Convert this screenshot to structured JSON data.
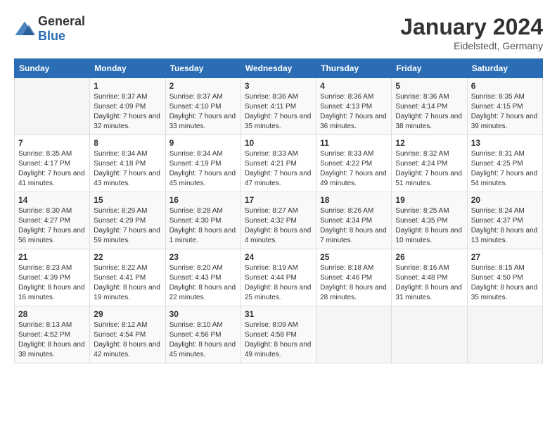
{
  "logo": {
    "general": "General",
    "blue": "Blue"
  },
  "header": {
    "month_year": "January 2024",
    "location": "Eidelstedt, Germany"
  },
  "weekdays": [
    "Sunday",
    "Monday",
    "Tuesday",
    "Wednesday",
    "Thursday",
    "Friday",
    "Saturday"
  ],
  "weeks": [
    [
      {
        "day": "",
        "sunrise": "",
        "sunset": "",
        "daylight": ""
      },
      {
        "day": "1",
        "sunrise": "Sunrise: 8:37 AM",
        "sunset": "Sunset: 4:09 PM",
        "daylight": "Daylight: 7 hours and 32 minutes."
      },
      {
        "day": "2",
        "sunrise": "Sunrise: 8:37 AM",
        "sunset": "Sunset: 4:10 PM",
        "daylight": "Daylight: 7 hours and 33 minutes."
      },
      {
        "day": "3",
        "sunrise": "Sunrise: 8:36 AM",
        "sunset": "Sunset: 4:11 PM",
        "daylight": "Daylight: 7 hours and 35 minutes."
      },
      {
        "day": "4",
        "sunrise": "Sunrise: 8:36 AM",
        "sunset": "Sunset: 4:13 PM",
        "daylight": "Daylight: 7 hours and 36 minutes."
      },
      {
        "day": "5",
        "sunrise": "Sunrise: 8:36 AM",
        "sunset": "Sunset: 4:14 PM",
        "daylight": "Daylight: 7 hours and 38 minutes."
      },
      {
        "day": "6",
        "sunrise": "Sunrise: 8:35 AM",
        "sunset": "Sunset: 4:15 PM",
        "daylight": "Daylight: 7 hours and 39 minutes."
      }
    ],
    [
      {
        "day": "7",
        "sunrise": "Sunrise: 8:35 AM",
        "sunset": "Sunset: 4:17 PM",
        "daylight": "Daylight: 7 hours and 41 minutes."
      },
      {
        "day": "8",
        "sunrise": "Sunrise: 8:34 AM",
        "sunset": "Sunset: 4:18 PM",
        "daylight": "Daylight: 7 hours and 43 minutes."
      },
      {
        "day": "9",
        "sunrise": "Sunrise: 8:34 AM",
        "sunset": "Sunset: 4:19 PM",
        "daylight": "Daylight: 7 hours and 45 minutes."
      },
      {
        "day": "10",
        "sunrise": "Sunrise: 8:33 AM",
        "sunset": "Sunset: 4:21 PM",
        "daylight": "Daylight: 7 hours and 47 minutes."
      },
      {
        "day": "11",
        "sunrise": "Sunrise: 8:33 AM",
        "sunset": "Sunset: 4:22 PM",
        "daylight": "Daylight: 7 hours and 49 minutes."
      },
      {
        "day": "12",
        "sunrise": "Sunrise: 8:32 AM",
        "sunset": "Sunset: 4:24 PM",
        "daylight": "Daylight: 7 hours and 51 minutes."
      },
      {
        "day": "13",
        "sunrise": "Sunrise: 8:31 AM",
        "sunset": "Sunset: 4:25 PM",
        "daylight": "Daylight: 7 hours and 54 minutes."
      }
    ],
    [
      {
        "day": "14",
        "sunrise": "Sunrise: 8:30 AM",
        "sunset": "Sunset: 4:27 PM",
        "daylight": "Daylight: 7 hours and 56 minutes."
      },
      {
        "day": "15",
        "sunrise": "Sunrise: 8:29 AM",
        "sunset": "Sunset: 4:29 PM",
        "daylight": "Daylight: 7 hours and 59 minutes."
      },
      {
        "day": "16",
        "sunrise": "Sunrise: 8:28 AM",
        "sunset": "Sunset: 4:30 PM",
        "daylight": "Daylight: 8 hours and 1 minute."
      },
      {
        "day": "17",
        "sunrise": "Sunrise: 8:27 AM",
        "sunset": "Sunset: 4:32 PM",
        "daylight": "Daylight: 8 hours and 4 minutes."
      },
      {
        "day": "18",
        "sunrise": "Sunrise: 8:26 AM",
        "sunset": "Sunset: 4:34 PM",
        "daylight": "Daylight: 8 hours and 7 minutes."
      },
      {
        "day": "19",
        "sunrise": "Sunrise: 8:25 AM",
        "sunset": "Sunset: 4:35 PM",
        "daylight": "Daylight: 8 hours and 10 minutes."
      },
      {
        "day": "20",
        "sunrise": "Sunrise: 8:24 AM",
        "sunset": "Sunset: 4:37 PM",
        "daylight": "Daylight: 8 hours and 13 minutes."
      }
    ],
    [
      {
        "day": "21",
        "sunrise": "Sunrise: 8:23 AM",
        "sunset": "Sunset: 4:39 PM",
        "daylight": "Daylight: 8 hours and 16 minutes."
      },
      {
        "day": "22",
        "sunrise": "Sunrise: 8:22 AM",
        "sunset": "Sunset: 4:41 PM",
        "daylight": "Daylight: 8 hours and 19 minutes."
      },
      {
        "day": "23",
        "sunrise": "Sunrise: 8:20 AM",
        "sunset": "Sunset: 4:43 PM",
        "daylight": "Daylight: 8 hours and 22 minutes."
      },
      {
        "day": "24",
        "sunrise": "Sunrise: 8:19 AM",
        "sunset": "Sunset: 4:44 PM",
        "daylight": "Daylight: 8 hours and 25 minutes."
      },
      {
        "day": "25",
        "sunrise": "Sunrise: 8:18 AM",
        "sunset": "Sunset: 4:46 PM",
        "daylight": "Daylight: 8 hours and 28 minutes."
      },
      {
        "day": "26",
        "sunrise": "Sunrise: 8:16 AM",
        "sunset": "Sunset: 4:48 PM",
        "daylight": "Daylight: 8 hours and 31 minutes."
      },
      {
        "day": "27",
        "sunrise": "Sunrise: 8:15 AM",
        "sunset": "Sunset: 4:50 PM",
        "daylight": "Daylight: 8 hours and 35 minutes."
      }
    ],
    [
      {
        "day": "28",
        "sunrise": "Sunrise: 8:13 AM",
        "sunset": "Sunset: 4:52 PM",
        "daylight": "Daylight: 8 hours and 38 minutes."
      },
      {
        "day": "29",
        "sunrise": "Sunrise: 8:12 AM",
        "sunset": "Sunset: 4:54 PM",
        "daylight": "Daylight: 8 hours and 42 minutes."
      },
      {
        "day": "30",
        "sunrise": "Sunrise: 8:10 AM",
        "sunset": "Sunset: 4:56 PM",
        "daylight": "Daylight: 8 hours and 45 minutes."
      },
      {
        "day": "31",
        "sunrise": "Sunrise: 8:09 AM",
        "sunset": "Sunset: 4:58 PM",
        "daylight": "Daylight: 8 hours and 49 minutes."
      },
      {
        "day": "",
        "sunrise": "",
        "sunset": "",
        "daylight": ""
      },
      {
        "day": "",
        "sunrise": "",
        "sunset": "",
        "daylight": ""
      },
      {
        "day": "",
        "sunrise": "",
        "sunset": "",
        "daylight": ""
      }
    ]
  ]
}
